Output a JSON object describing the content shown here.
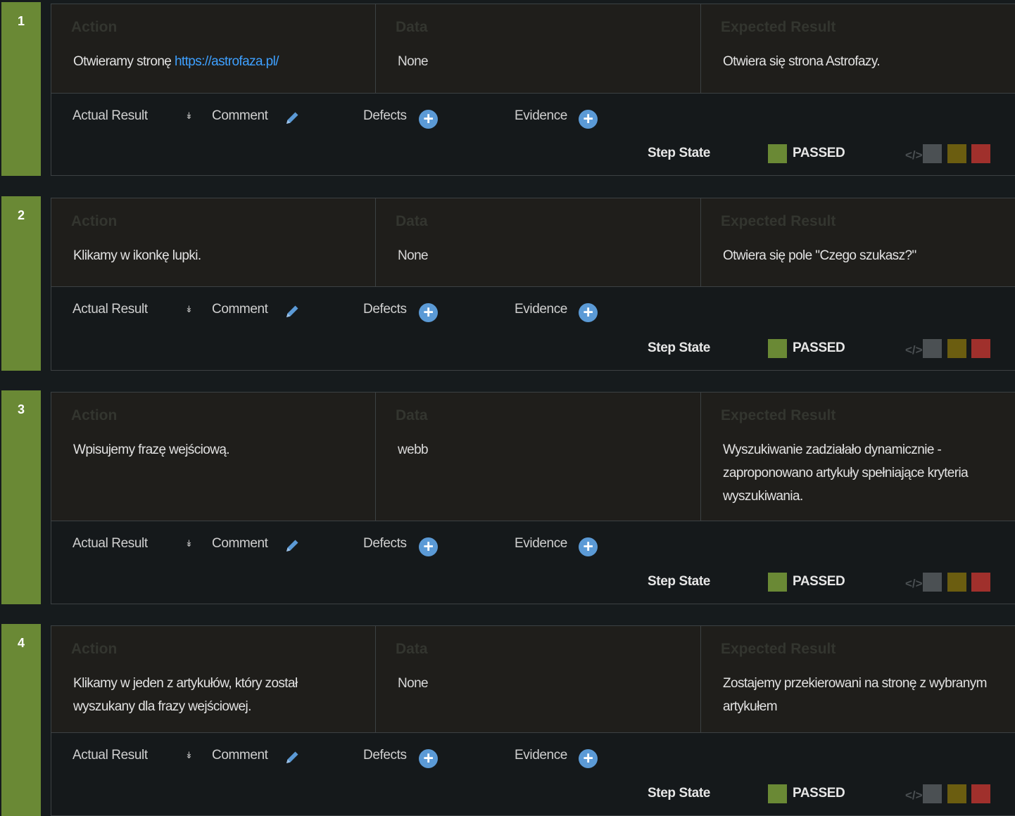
{
  "labels": {
    "action": "Action",
    "data": "Data",
    "expected": "Expected Result",
    "actual_result": "Actual Result",
    "comment": "Comment",
    "defects": "Defects",
    "evidence": "Evidence",
    "step_state": "Step State"
  },
  "colors": {
    "passed": "#6a8935",
    "state_gray": "#4b5053",
    "state_olive": "#6b5d10",
    "state_red": "#a0302c",
    "link": "#3ea0ff"
  },
  "steps": [
    {
      "number": "1",
      "action_prefix": "Otwieramy stronę ",
      "action_link": "https://astrofaza.pl/",
      "data": "None",
      "expected": "Otwiera się strona Astrofazy.",
      "state": "PASSED"
    },
    {
      "number": "2",
      "action_prefix": "Klikamy w ikonkę lupki.",
      "action_link": "",
      "data": "None",
      "expected": "Otwiera się pole \"Czego szukasz?\"",
      "state": "PASSED"
    },
    {
      "number": "3",
      "action_prefix": "Wpisujemy frazę wejściową.",
      "action_link": "",
      "data": "webb",
      "expected": "Wyszukiwanie zadziałało dynamicznie - zaproponowano artykuły spełniające kryteria wyszukiwania.",
      "state": "PASSED"
    },
    {
      "number": "4",
      "action_prefix": "Klikamy w jeden z artykułów, który został wyszukany dla frazy wejściowej.",
      "action_link": "",
      "data": "None",
      "expected": "Zostajemy przekierowani na stronę z wybranym artykułem",
      "state": "PASSED"
    }
  ]
}
